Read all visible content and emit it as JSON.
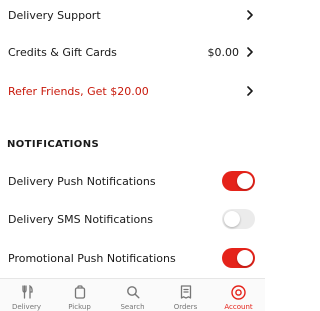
{
  "menu": {
    "delivery_support": "Delivery Support",
    "credits_label": "Credits & Gift Cards",
    "credits_value": "$0.00",
    "refer_label": "Refer Friends, Get $20.00"
  },
  "notifications": {
    "title": "NOTIFICATIONS",
    "items": [
      {
        "label": "Delivery Push Notifications",
        "enabled": true
      },
      {
        "label": "Delivery SMS Notifications",
        "enabled": false
      },
      {
        "label": "Promotional Push Notifications",
        "enabled": true
      }
    ]
  },
  "tabbar": {
    "tabs": [
      {
        "label": "Delivery",
        "icon": "fork-knife-icon",
        "active": false
      },
      {
        "label": "Pickup",
        "icon": "bag-icon",
        "active": false
      },
      {
        "label": "Search",
        "icon": "search-icon",
        "active": false
      },
      {
        "label": "Orders",
        "icon": "receipt-icon",
        "active": false
      },
      {
        "label": "Account",
        "icon": "account-icon",
        "active": true
      }
    ]
  },
  "colors": {
    "accent": "#e5231a",
    "toggle_off": "#ebebeb",
    "text": "#191919",
    "muted": "#767676"
  }
}
